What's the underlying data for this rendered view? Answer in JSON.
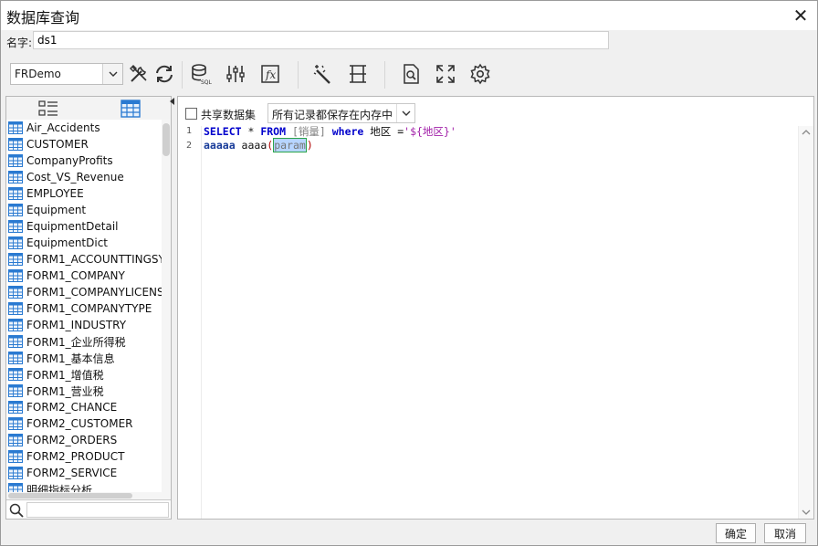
{
  "window": {
    "title": "数据库查询",
    "close_glyph": "✕"
  },
  "name_row": {
    "label": "名字:",
    "value": "ds1"
  },
  "toolbar": {
    "database_select": {
      "value": "FRDemo"
    },
    "buttons": [
      {
        "name": "tools-icon"
      },
      {
        "name": "refresh-icon"
      },
      {
        "name": "database-sql-icon"
      },
      {
        "name": "parameters-icon"
      },
      {
        "name": "formula-icon"
      },
      {
        "name": "magic-wand-icon"
      },
      {
        "name": "split-layout-icon"
      },
      {
        "name": "preview-icon"
      },
      {
        "name": "fullscreen-icon"
      },
      {
        "name": "settings-icon"
      }
    ]
  },
  "left_panel": {
    "tabs": [
      {
        "name": "list-view-icon"
      },
      {
        "name": "table-view-icon"
      }
    ],
    "tables": [
      "Air_Accidents",
      "CUSTOMER",
      "CompanyProfits",
      "Cost_VS_Revenue",
      "EMPLOYEE",
      "Equipment",
      "EquipmentDetail",
      "EquipmentDict",
      "FORM1_ACCOUNTTINGSY",
      "FORM1_COMPANY",
      "FORM1_COMPANYLICENS",
      "FORM1_COMPANYTYPE",
      "FORM1_INDUSTRY",
      "FORM1_企业所得税",
      "FORM1_基本信息",
      "FORM1_增值税",
      "FORM1_营业税",
      "FORM2_CHANCE",
      "FORM2_CUSTOMER",
      "FORM2_ORDERS",
      "FORM2_PRODUCT",
      "FORM2_SERVICE",
      "明细指标分析"
    ],
    "search_placeholder": ""
  },
  "right_panel": {
    "share_label": "共享数据集",
    "share_checked": false,
    "cache_select": {
      "value": "所有记录都保存在内存中"
    }
  },
  "editor": {
    "line_numbers": [
      "1",
      "2"
    ],
    "line1": {
      "select": "SELECT",
      "star": " * ",
      "from": "FROM",
      "table": " [销量] ",
      "where": "where",
      "column": " 地区 =",
      "value": "'${地区}'"
    },
    "line2": {
      "prefix": "aaaaa",
      "mid": " aaaa",
      "open": "(",
      "param": "param",
      "close": ")"
    }
  },
  "footer": {
    "ok_label": "确定",
    "cancel_label": "取消"
  },
  "colors": {
    "keyword": "#0000cc",
    "string": "#a11fa8",
    "table_name": "#808080",
    "selection": "#b7d5ff"
  }
}
